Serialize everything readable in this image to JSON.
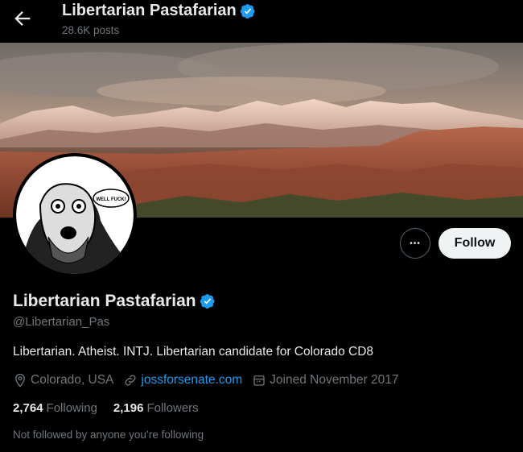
{
  "header": {
    "title": "Libertarian Pastafarian",
    "posts_count": "28.6K posts",
    "back_icon": "arrow-left-icon"
  },
  "profile": {
    "name": "Libertarian Pastafarian",
    "handle": "@Libertarian_Pas",
    "bio": "Libertarian. Atheist. INTJ. Libertarian candidate for Colorado CD8",
    "location": "Colorado, USA",
    "website": "jossforsenate.com",
    "joined": "Joined November 2017",
    "following_count": "2,764",
    "following_label": "Following",
    "followers_count": "2,196",
    "followers_label": "Followers",
    "not_followed_text": "Not followed by anyone you’re following",
    "avatar_caption": "WELL FUCK!"
  },
  "actions": {
    "follow_label": "Follow",
    "more_label": "•••"
  },
  "colors": {
    "background": "#000000",
    "accent": "#1d9bf0",
    "text_secondary": "#71767b",
    "follow_bg": "#eff3f4"
  }
}
